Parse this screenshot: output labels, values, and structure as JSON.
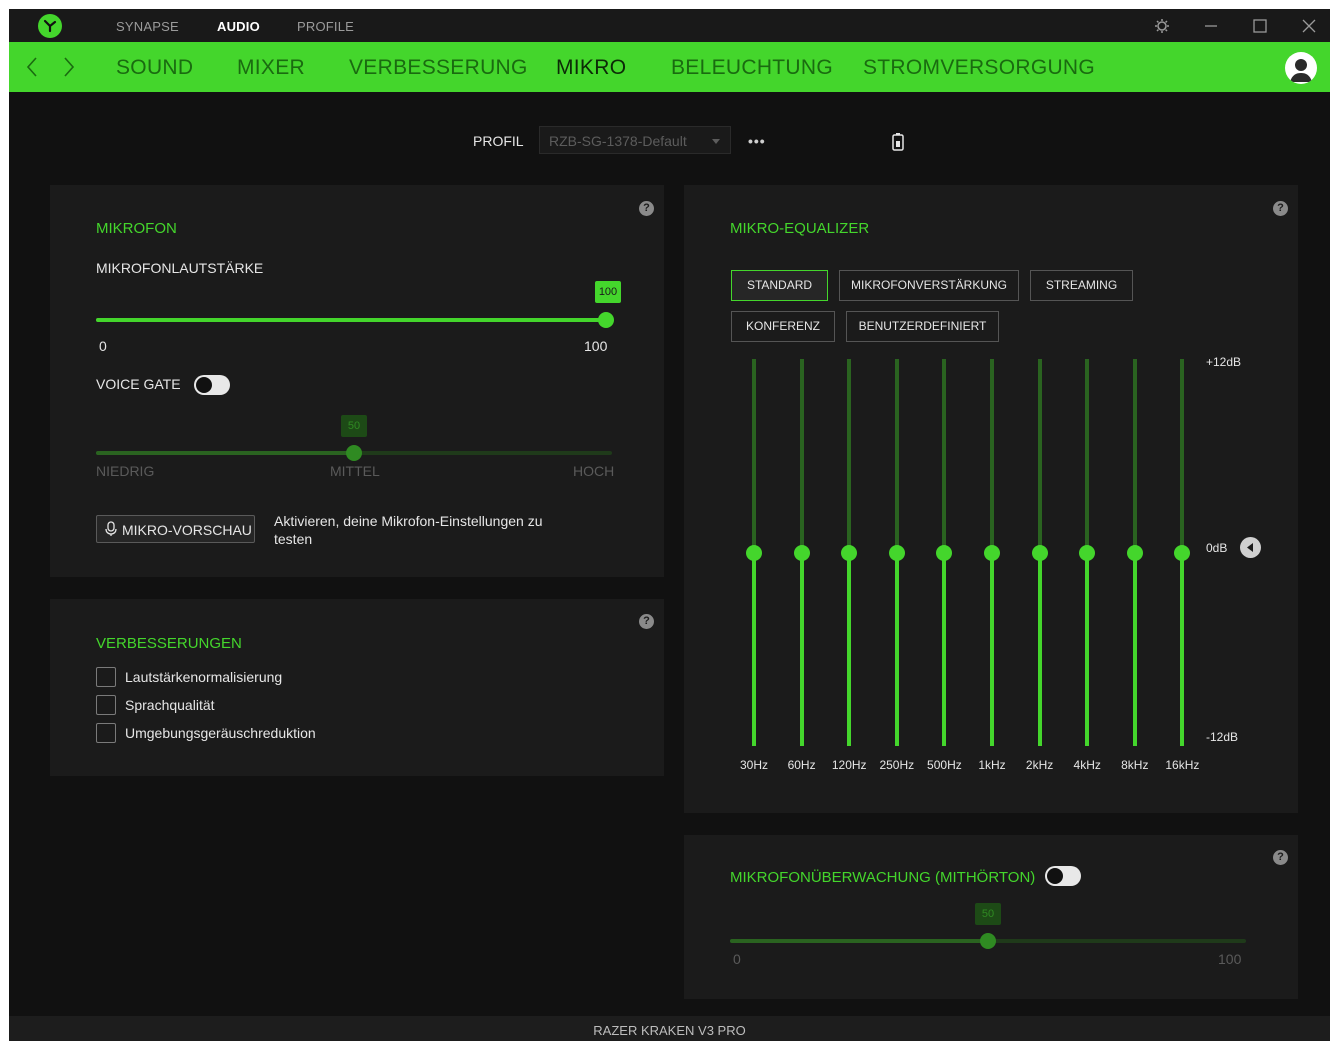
{
  "titlebar": {
    "tabs": [
      "SYNAPSE",
      "AUDIO",
      "PROFILE"
    ],
    "active_tab": "AUDIO"
  },
  "navbar": {
    "tabs": [
      "SOUND",
      "MIXER",
      "VERBESSERUNG",
      "MIKRO",
      "BELEUCHTUNG",
      "STROMVERSORGUNG"
    ],
    "active_tab": "MIKRO"
  },
  "profile": {
    "label": "PROFIL",
    "selected": "RZB-SG-1378-Default",
    "more": "•••"
  },
  "mikrofon": {
    "title": "MIKROFON",
    "volume_label": "MIKROFONLAUTSTÄRKE",
    "volume_value": "100",
    "volume_fraction": 1.0,
    "volume_min": "0",
    "volume_max": "100",
    "voice_gate_label": "VOICE GATE",
    "voice_gate_value": "50",
    "voice_gate_fraction": 0.5,
    "gate_low": "NIEDRIG",
    "gate_mid": "MITTEL",
    "gate_high": "HOCH",
    "preview_button": "MIKRO-VORSCHAU",
    "preview_text_1": "Aktivieren, deine Mikrofon-Einstellungen zu",
    "preview_text_2": "testen"
  },
  "verbesserungen": {
    "title": "VERBESSERUNGEN",
    "items": [
      "Lautstärkenormalisierung",
      "Sprachqualität",
      "Umgebungsgeräuschreduktion"
    ]
  },
  "equalizer": {
    "title": "MIKRO-EQUALIZER",
    "presets": [
      "STANDARD",
      "MIKROFONVERSTÄRKUNG",
      "STREAMING",
      "KONFERENZ",
      "BENUTZERDEFINIERT"
    ],
    "active_preset": "STANDARD",
    "bands": [
      "30Hz",
      "60Hz",
      "120Hz",
      "250Hz",
      "500Hz",
      "1kHz",
      "2kHz",
      "4kHz",
      "8kHz",
      "16kHz"
    ],
    "gains_db": [
      0,
      0,
      0,
      0,
      0,
      0,
      0,
      0,
      0,
      0
    ],
    "db_max": "+12dB",
    "db_zero": "0dB",
    "db_min": "-12dB"
  },
  "monitoring": {
    "title": "MIKROFONÜBERWACHUNG (MITHÖRTON)",
    "value": "50",
    "fraction": 0.5,
    "min": "0",
    "max": "100"
  },
  "footer": {
    "device": "RAZER KRAKEN V3 PRO"
  },
  "colors": {
    "accent": "#44d62c",
    "background": "#111111",
    "panel": "#1b1b1b"
  }
}
